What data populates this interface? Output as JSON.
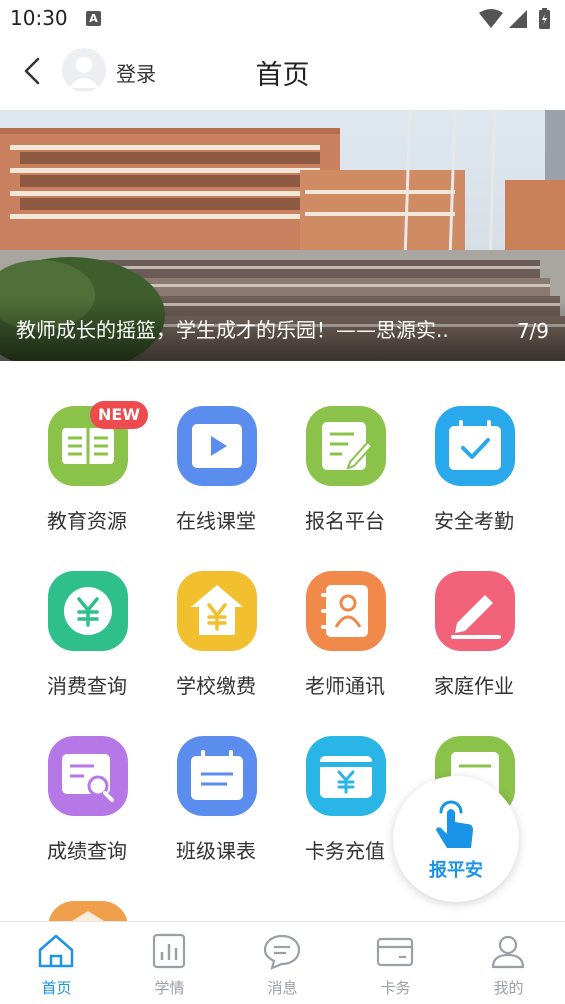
{
  "status_bar": {
    "time": "10:30",
    "notification_badge": "A",
    "icons": [
      "wifi-icon",
      "signal-icon",
      "battery-icon"
    ]
  },
  "header": {
    "login_label": "登录",
    "title": "首页"
  },
  "banner": {
    "caption": "教师成长的摇篮，学生成才的乐园！——思源实..",
    "index": "7/9"
  },
  "grid": {
    "new_badge": "NEW",
    "items": [
      {
        "label": "教育资源",
        "icon": "book-icon",
        "color": "#8bc34a"
      },
      {
        "label": "在线课堂",
        "icon": "video-play-icon",
        "color": "#5b8def"
      },
      {
        "label": "报名平台",
        "icon": "edit-document-icon",
        "color": "#8bc34a"
      },
      {
        "label": "安全考勤",
        "icon": "calendar-check-icon",
        "color": "#29a9ec"
      },
      {
        "label": "消费查询",
        "icon": "yuan-coin-icon",
        "color": "#2fbf8a"
      },
      {
        "label": "学校缴费",
        "icon": "yuan-house-icon",
        "color": "#f2bf2e"
      },
      {
        "label": "老师通讯",
        "icon": "contact-book-icon",
        "color": "#f0894a"
      },
      {
        "label": "家庭作业",
        "icon": "pencil-icon",
        "color": "#f2637a"
      },
      {
        "label": "成绩查询",
        "icon": "search-document-icon",
        "color": "#b678e6"
      },
      {
        "label": "班级课表",
        "icon": "schedule-icon",
        "color": "#5b8def"
      },
      {
        "label": "卡务充值",
        "icon": "card-recharge-icon",
        "color": "#29b6e6"
      },
      {
        "label": "",
        "icon": "document-icon",
        "color": "#8bc34a"
      }
    ]
  },
  "fab": {
    "label": "报平安",
    "icon": "tap-hand-icon"
  },
  "bottom_nav": {
    "active_color": "#1a94e6",
    "items": [
      {
        "label": "首页",
        "icon": "home-icon"
      },
      {
        "label": "学情",
        "icon": "bar-chart-icon"
      },
      {
        "label": "消息",
        "icon": "message-icon"
      },
      {
        "label": "卡务",
        "icon": "card-icon"
      },
      {
        "label": "我的",
        "icon": "user-icon"
      }
    ]
  }
}
